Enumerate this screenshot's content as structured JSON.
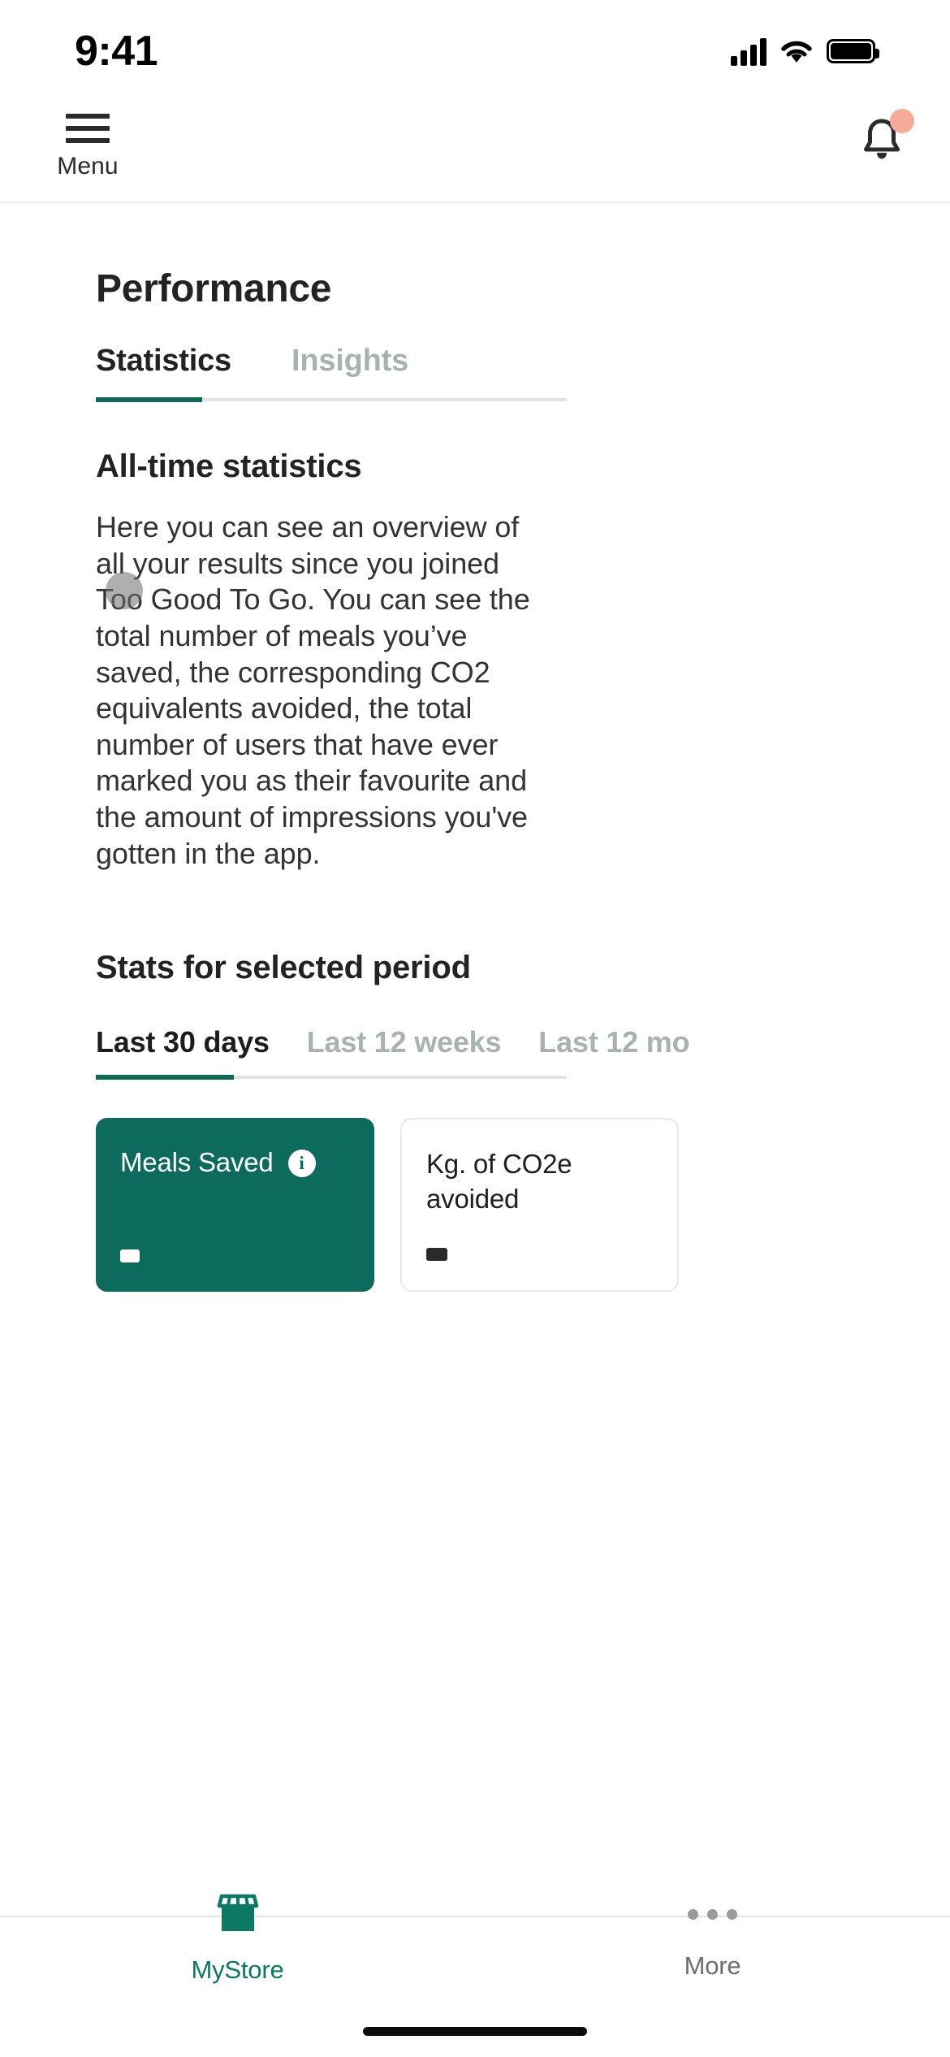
{
  "status_bar": {
    "time": "9:41",
    "icons": [
      "cellular-signal-icon",
      "wifi-icon",
      "battery-icon"
    ]
  },
  "appbar": {
    "menu_label": "Menu",
    "menu_icon": "hamburger-icon",
    "notification_icon": "bell-icon",
    "notification_badge": true
  },
  "header": {
    "page_title": "Performance"
  },
  "main_tabs": {
    "items": [
      {
        "label": "Statistics",
        "active": true
      },
      {
        "label": "Insights",
        "active": false
      }
    ]
  },
  "all_time": {
    "title": "All-time statistics",
    "description": "Here you can see an overview of all your results since you joined Too Good To Go. You can see the total number of meals you’ve saved, the corresponding CO2 equivalents avoided, the total number of users that have ever marked you as their favourite and the amount of impressions you've gotten in the app."
  },
  "period_section": {
    "title": "Stats for selected period",
    "tabs": [
      {
        "label": "Last 30 days",
        "active": true
      },
      {
        "label": "Last 12 weeks",
        "active": false
      },
      {
        "label": "Last 12 mo",
        "active": false
      }
    ]
  },
  "stat_cards": [
    {
      "title": "Meals Saved",
      "value": "",
      "has_info_icon": true,
      "info_icon": "info-icon",
      "style": "primary"
    },
    {
      "title": "Kg. of CO2e avoided",
      "value": "",
      "has_info_icon": false,
      "style": "plain"
    }
  ],
  "bottom_nav": {
    "items": [
      {
        "label": "MyStore",
        "icon": "storefront-icon",
        "active": true
      },
      {
        "label": "More",
        "icon": "ellipsis-icon",
        "active": false
      }
    ]
  },
  "colors": {
    "brand_teal": "#0C6B5C",
    "accent_underline": "#0C6B56",
    "nav_active": "#0C7A63",
    "badge_pink": "#F7A99A",
    "muted_text": "#A8B2AF"
  }
}
